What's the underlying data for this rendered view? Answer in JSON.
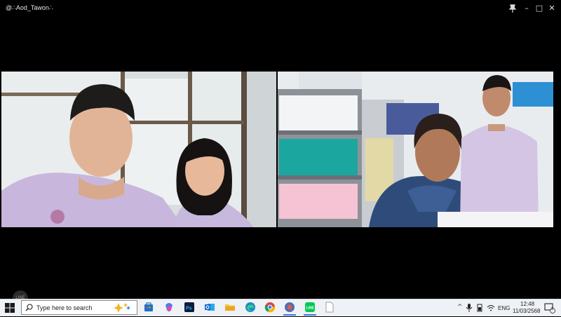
{
  "window": {
    "title": "@∴Aod_Tawon∴",
    "controls": {
      "pin": "pin-icon",
      "minimize": "–",
      "maximize": "□",
      "close": "✕"
    }
  },
  "call": {
    "participants": [
      {
        "tile": "left",
        "description_icon": "video-feed-icon"
      },
      {
        "tile": "right",
        "description_icon": "video-feed-icon"
      }
    ],
    "chat_button_label": "LINE"
  },
  "taskbar": {
    "search_placeholder": "Type here to search",
    "apps": [
      "copilot-icon",
      "store-icon",
      "copilot-app-icon",
      "photoshop-icon",
      "outlook-icon",
      "file-explorer-icon",
      "edge-icon",
      "chrome-icon",
      "app-icon",
      "line-icon",
      "document-icon"
    ],
    "tray": {
      "language": "ENG",
      "time": "12:48",
      "date": "11/03/2568",
      "notification_count": "2"
    }
  }
}
